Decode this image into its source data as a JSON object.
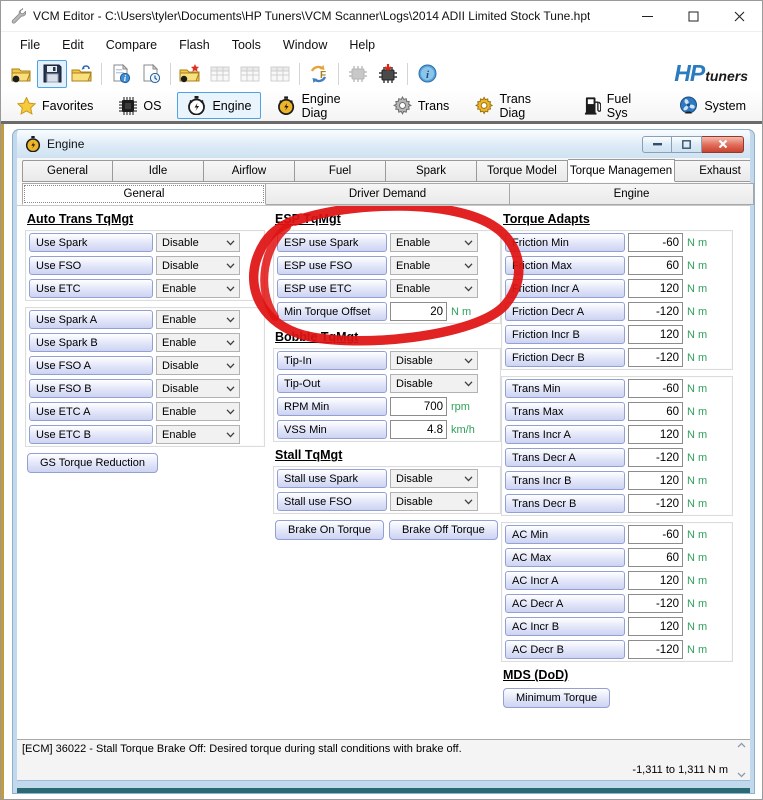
{
  "window": {
    "title": "VCM Editor - C:\\Users\\tyler\\Documents\\HP Tuners\\VCM Scanner\\Logs\\2014 ADII Limited Stock Tune.hpt"
  },
  "menu": [
    "File",
    "Edit",
    "Compare",
    "Flash",
    "Tools",
    "Window",
    "Help"
  ],
  "toolbar_icons": [
    "open-file",
    "save-file",
    "close-file",
    "file-info",
    "file-history",
    "new-compare",
    "table-view-1",
    "table-view-2",
    "table-view-3",
    "compare-swap",
    "read-vehicle",
    "write-vehicle",
    "info"
  ],
  "brand": {
    "hp": "HP",
    "tuners": "tuners"
  },
  "nav": [
    {
      "label": "Favorites"
    },
    {
      "label": "OS"
    },
    {
      "label": "Engine"
    },
    {
      "label": "Engine Diag"
    },
    {
      "label": "Trans"
    },
    {
      "label": "Trans Diag"
    },
    {
      "label": "Fuel Sys"
    },
    {
      "label": "System"
    }
  ],
  "child": {
    "title": "Engine",
    "tabs": [
      "General",
      "Idle",
      "Airflow",
      "Fuel",
      "Spark",
      "Torque Model",
      "Torque Managemen",
      "Exhaust"
    ],
    "selected_tab": "Torque Managemen",
    "subtabs": [
      "General",
      "Driver Demand",
      "Engine"
    ],
    "selected_subtab": "General"
  },
  "columns": {
    "left": {
      "blocks": [
        {
          "type": "header",
          "text": "Auto Trans TqMgt"
        },
        {
          "type": "group",
          "rows": [
            {
              "kind": "select",
              "label": "Use Spark",
              "value": "Disable"
            },
            {
              "kind": "select",
              "label": "Use FSO",
              "value": "Disable"
            },
            {
              "kind": "select",
              "label": "Use ETC",
              "value": "Enable"
            }
          ]
        },
        {
          "type": "group",
          "rows": [
            {
              "kind": "select",
              "label": "Use Spark A",
              "value": "Enable"
            },
            {
              "kind": "select",
              "label": "Use Spark B",
              "value": "Enable"
            },
            {
              "kind": "select",
              "label": "Use FSO A",
              "value": "Disable"
            },
            {
              "kind": "select",
              "label": "Use FSO B",
              "value": "Disable"
            },
            {
              "kind": "select",
              "label": "Use ETC A",
              "value": "Enable"
            },
            {
              "kind": "select",
              "label": "Use ETC B",
              "value": "Enable"
            }
          ]
        },
        {
          "type": "buttons",
          "buttons": [
            "GS Torque Reduction"
          ]
        }
      ]
    },
    "middle": {
      "blocks": [
        {
          "type": "header",
          "text": "ESP TqMgt"
        },
        {
          "type": "group",
          "rows": [
            {
              "kind": "select",
              "label": "ESP use Spark",
              "value": "Enable"
            },
            {
              "kind": "select",
              "label": "ESP use FSO",
              "value": "Enable"
            },
            {
              "kind": "select",
              "label": "ESP use ETC",
              "value": "Enable"
            },
            {
              "kind": "input",
              "label": "Min Torque Offset",
              "value": "20",
              "unit": "N m"
            }
          ]
        },
        {
          "type": "header",
          "text": "Bobble TqMgt"
        },
        {
          "type": "group",
          "rows": [
            {
              "kind": "select",
              "label": "Tip-In",
              "value": "Disable"
            },
            {
              "kind": "select",
              "label": "Tip-Out",
              "value": "Disable"
            },
            {
              "kind": "input",
              "label": "RPM Min",
              "value": "700",
              "unit": "rpm"
            },
            {
              "kind": "input",
              "label": "VSS Min",
              "value": "4.8",
              "unit": "km/h"
            }
          ]
        },
        {
          "type": "header",
          "text": "Stall TqMgt"
        },
        {
          "type": "group",
          "rows": [
            {
              "kind": "select",
              "label": "Stall use Spark",
              "value": "Disable"
            },
            {
              "kind": "select",
              "label": "Stall use FSO",
              "value": "Disable"
            }
          ]
        },
        {
          "type": "buttons",
          "buttons": [
            "Brake On Torque",
            "Brake Off Torque"
          ]
        }
      ]
    },
    "right": {
      "blocks": [
        {
          "type": "header",
          "text": "Torque Adapts"
        },
        {
          "type": "group",
          "rows": [
            {
              "kind": "input",
              "label": "Friction Min",
              "value": "-60",
              "unit": "N m"
            },
            {
              "kind": "input",
              "label": "Friction Max",
              "value": "60",
              "unit": "N m"
            },
            {
              "kind": "input",
              "label": "Friction Incr A",
              "value": "120",
              "unit": "N m"
            },
            {
              "kind": "input",
              "label": "Friction Decr A",
              "value": "-120",
              "unit": "N m"
            },
            {
              "kind": "input",
              "label": "Friction Incr B",
              "value": "120",
              "unit": "N m"
            },
            {
              "kind": "input",
              "label": "Friction Decr B",
              "value": "-120",
              "unit": "N m"
            }
          ]
        },
        {
          "type": "group",
          "rows": [
            {
              "kind": "input",
              "label": "Trans Min",
              "value": "-60",
              "unit": "N m"
            },
            {
              "kind": "input",
              "label": "Trans Max",
              "value": "60",
              "unit": "N m"
            },
            {
              "kind": "input",
              "label": "Trans Incr A",
              "value": "120",
              "unit": "N m"
            },
            {
              "kind": "input",
              "label": "Trans Decr A",
              "value": "-120",
              "unit": "N m"
            },
            {
              "kind": "input",
              "label": "Trans Incr B",
              "value": "120",
              "unit": "N m"
            },
            {
              "kind": "input",
              "label": "Trans Decr B",
              "value": "-120",
              "unit": "N m"
            }
          ]
        },
        {
          "type": "group",
          "rows": [
            {
              "kind": "input",
              "label": "AC Min",
              "value": "-60",
              "unit": "N m"
            },
            {
              "kind": "input",
              "label": "AC Max",
              "value": "60",
              "unit": "N m"
            },
            {
              "kind": "input",
              "label": "AC Incr A",
              "value": "120",
              "unit": "N m"
            },
            {
              "kind": "input",
              "label": "AC Decr A",
              "value": "-120",
              "unit": "N m"
            },
            {
              "kind": "input",
              "label": "AC Incr B",
              "value": "120",
              "unit": "N m"
            },
            {
              "kind": "input",
              "label": "AC Decr B",
              "value": "-120",
              "unit": "N m"
            }
          ]
        },
        {
          "type": "header",
          "text": "MDS (DoD)"
        },
        {
          "type": "buttons",
          "buttons": [
            "Minimum Torque"
          ]
        }
      ]
    }
  },
  "status": {
    "message": "[ECM] 36022 - Stall Torque Brake Off: Desired torque during stall conditions with brake off.",
    "range": "-1,311 to 1,311 N m"
  },
  "colors": {
    "brand_blue": "#2b7bbf",
    "unit_green": "#2fa05a",
    "annotation_red": "#e01212",
    "selection_blue": "#4da3e8",
    "frame_gold": "#c59b3f"
  }
}
